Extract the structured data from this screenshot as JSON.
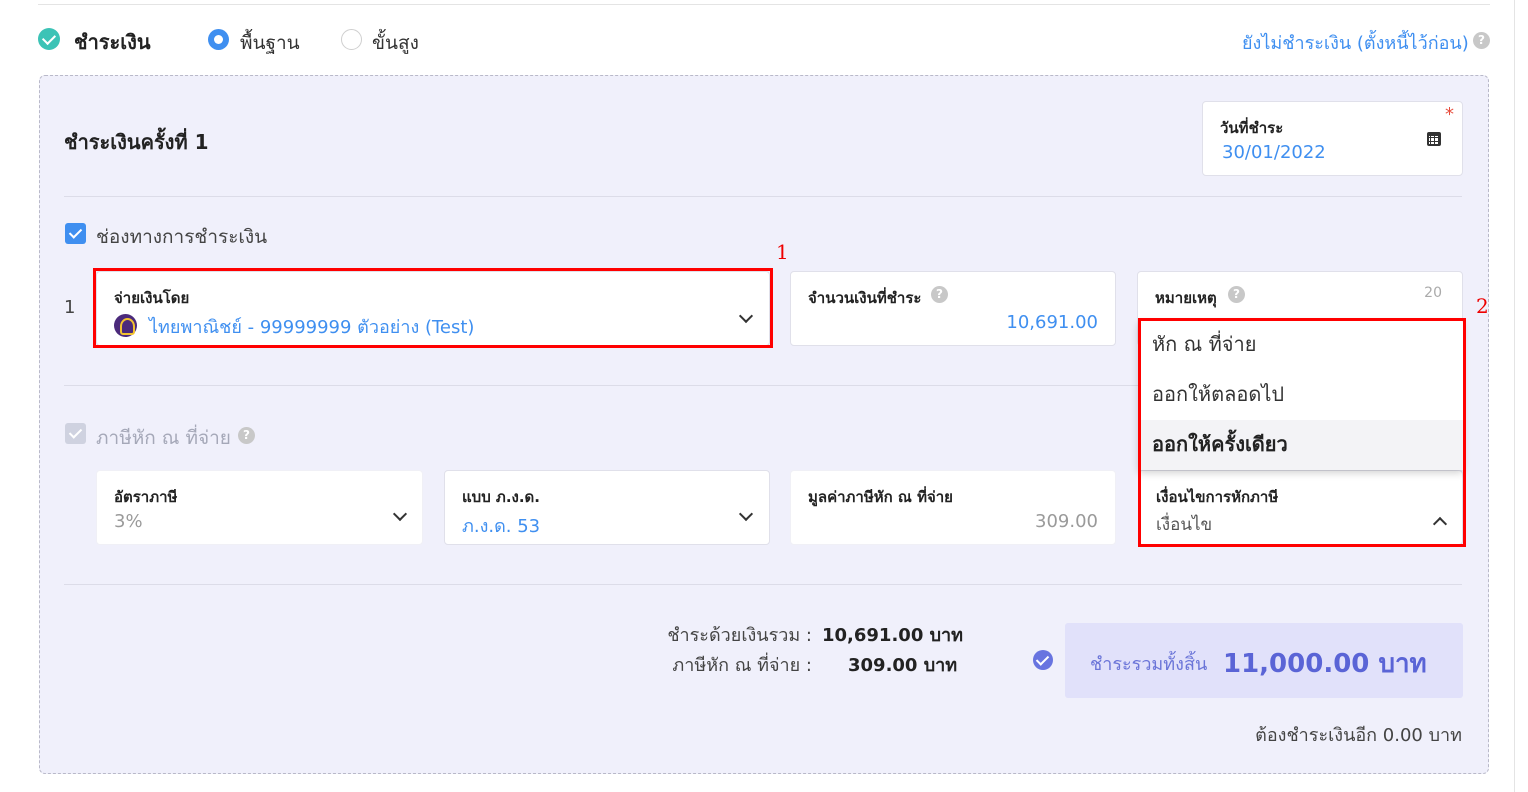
{
  "header": {
    "title": "ชำระเงิน",
    "mode_basic": "พื้นฐาน",
    "mode_advanced": "ขั้นสูง",
    "defer_link": "ยังไม่ชำระเงิน (ตั้งหนี้ไว้ก่อน)",
    "selected_mode": "พื้นฐาน"
  },
  "payment": {
    "title": "ชำระเงินครั้งที่ 1",
    "date_label": "วันที่ชำระ",
    "date_value": "30/01/2022",
    "required_mark": "*",
    "channel_label": "ช่องทางการชำระเงิน",
    "row_number": "1",
    "pay_by_label": "จ่ายเงินโดย",
    "pay_by_value": "ไทยพาณิชย์ - 99999999 ตัวอย่าง (Test)",
    "amount_label": "จำนวนเงินที่ชำระ",
    "amount_value": "10,691.00",
    "note_label": "หมายเหตุ",
    "note_counter": "20"
  },
  "withholding": {
    "label": "ภาษีหัก ณ ที่จ่าย",
    "rate_label": "อัตราภาษี",
    "rate_value": "3%",
    "form_label": "แบบ ภ.ง.ด.",
    "form_value": "ภ.ง.ด. 53",
    "tax_value_label": "มูลค่าภาษีหัก ณ ที่จ่าย",
    "tax_value": "309.00",
    "condition_label": "เงื่อนไขการหักภาษี",
    "condition_placeholder": "เงื่อนไข",
    "condition_options": [
      "หัก ณ ที่จ่าย",
      "ออกให้ตลอดไป",
      "ออกให้ครั้งเดียว"
    ],
    "highlighted_option": "ออกให้ครั้งเดียว"
  },
  "summary": {
    "cash_label": "ชำระด้วยเงินรวม :",
    "cash_value": "10,691.00 บาท",
    "wht_label": "ภาษีหัก ณ ที่จ่าย :",
    "wht_value": "309.00 บาท",
    "total_label": "ชำระรวมทั้งสิ้น",
    "total_value": "11,000.00 บาท",
    "remaining": "ต้องชำระเงินอีก 0.00 บาท"
  },
  "annotations": {
    "marker_1": "1",
    "marker_2": "2"
  },
  "colors": {
    "accent": "#3f8ff0",
    "teal": "#3cc3b6",
    "panel_bg": "#f0f0fb",
    "total_bg": "#e1e1fa",
    "total_text": "#5a64d6",
    "annotation": "#ff0000"
  }
}
